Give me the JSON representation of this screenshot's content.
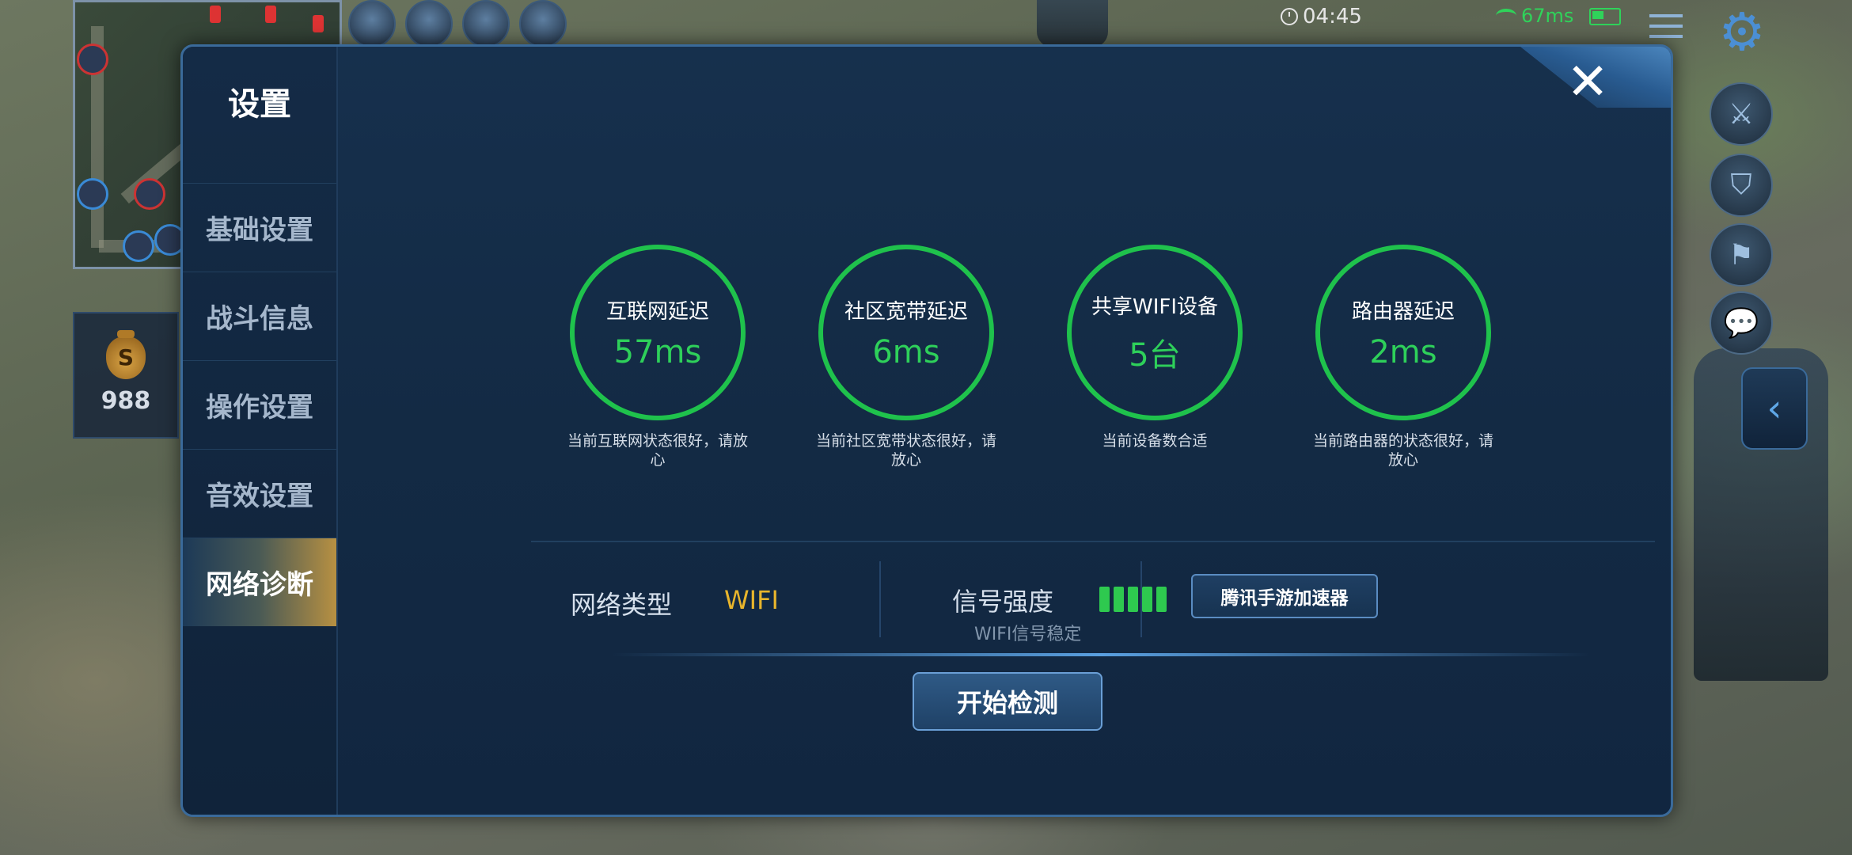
{
  "status_bar": {
    "time": "04:45",
    "signal": "67ms"
  },
  "hud": {
    "gold": "988"
  },
  "settings": {
    "title": "设置",
    "menu": [
      {
        "label": "基础设置",
        "active": false
      },
      {
        "label": "战斗信息",
        "active": false
      },
      {
        "label": "操作设置",
        "active": false
      },
      {
        "label": "音效设置",
        "active": false
      },
      {
        "label": "网络诊断",
        "active": true
      }
    ],
    "gauges": [
      {
        "label": "互联网延迟",
        "value": "57ms",
        "note": "当前互联网状态很好，请放心"
      },
      {
        "label": "社区宽带延迟",
        "value": "6ms",
        "note": "当前社区宽带状态很好，请放心"
      },
      {
        "label": "共享WIFI设备",
        "value": "5台",
        "note": "当前设备数合适"
      },
      {
        "label": "路由器延迟",
        "value": "2ms",
        "note": "当前路由器的状态很好，请放心"
      }
    ],
    "network_type_label": "网络类型",
    "network_type_value": "WIFI",
    "signal_label": "信号强度",
    "signal_level": 5,
    "signal_note": "WIFI信号稳定",
    "accelerator_button": "腾讯手游加速器",
    "start_button": "开始检测"
  },
  "colors": {
    "good": "#2ed05a",
    "accent_gold": "#e8b52c",
    "panel_bg": "#16304d"
  }
}
